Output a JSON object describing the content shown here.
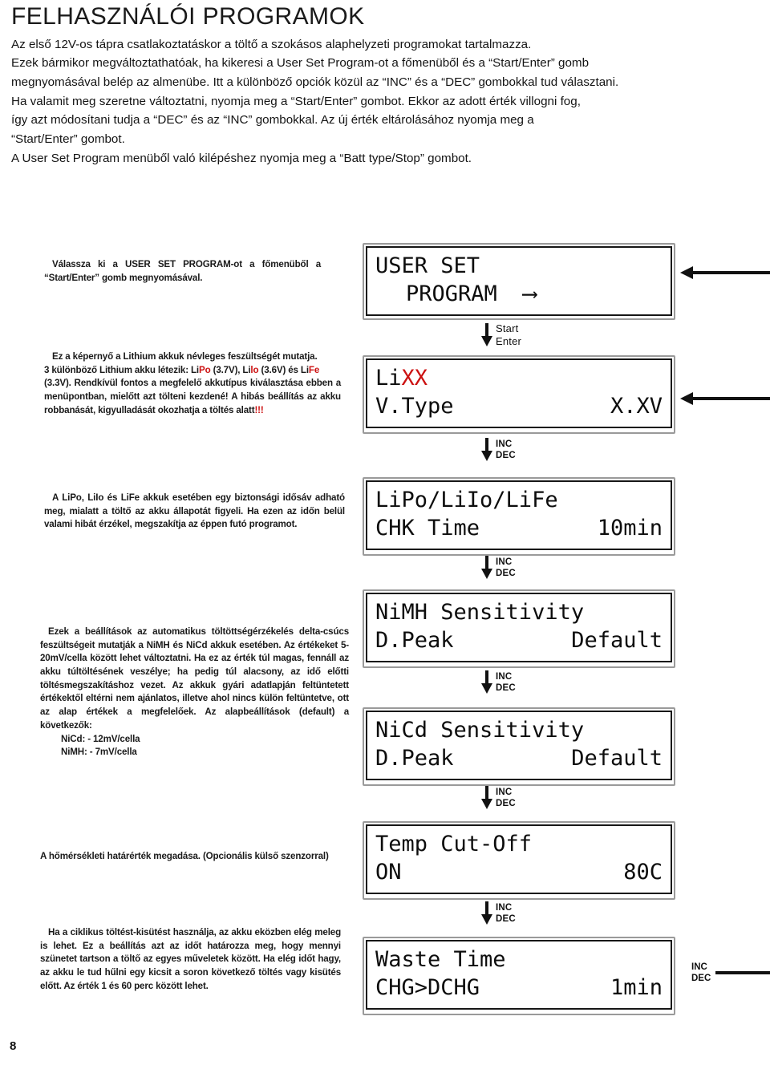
{
  "header": {
    "title": "FELHASZNÁLÓI PROGRAMOK",
    "paragraphs": [
      "Az első 12V-os tápra csatlakoztatáskor a töltő a szokásos alaphelyzeti programokat tartalmazza.",
      "Ezek bármikor megváltoztathatóak, ha kikeresi a User Set Program-ot a főmenüből és a “Start/Enter” gomb",
      "megnyomásával belép az almenübe. Itt a különböző opciók közül az “INC” és a “DEC” gombokkal tud választani.",
      "Ha valamit meg szeretne változtatni, nyomja meg a “Start/Enter” gombot. Ekkor az adott érték villogni fog,",
      "így azt módosítani tudja a “DEC” és az “INC” gombokkal. Az új érték eltárolásához nyomja meg a",
      "“Start/Enter” gombot.",
      "A User Set Program menüből való kilépéshez nyomja meg a “Batt type/Stop” gombot."
    ]
  },
  "notes": {
    "n1": "Válassza ki a USER SET PROGRAM-ot a főmenüből a “Start/Enter” gomb megnyomásával.",
    "n2_line1": "Ez a képernyő a Lithium akkuk névleges feszültségét mutatja.",
    "n2_line2_a": "3 különböző Lithium akku létezik: Li",
    "n2_red_po": "Po",
    "n2_line2_b": " (3.7V), Li",
    "n2_red_lo": "lo",
    "n2_line2_c": " (3.6V) és Li",
    "n2_red_fe": "Fe",
    "n2_line3": "(3.3V).  Rendkívül fontos a megfelelő akkutípus kiválasztása ebben a menüpontban, mielőtt azt tölteni kezdené! A hibás beállítás az akku robbanását, kigyulladását okozhatja a töltés alatt",
    "n2_red_bang": "!!!",
    "n3": "A LiPo, LiIo és LiFe akkuk esetében egy biztonsági idősáv adható meg, mialatt a töltő az akku állapotát figyeli. Ha ezen az időn belül valami hibát érzékel, megszakítja az éppen futó programot.",
    "n4_body": "Ezek a beállítások az automatikus töltöttségérzékelés delta-csúcs feszültségeit mutatják a NiMH és NiCd akkuk esetében. Az értékeket 5-20mV/cella között lehet változtatni. Ha ez az érték túl magas, fennáll az akku túltöltésének veszélye; ha pedig túl alacsony, az idő előtti töltésmegszakításhoz vezet. Az akkuk gyári adatlapján feltüntetett értékektől eltérni nem ajánlatos, illetve ahol nincs külön feltüntetve, ott az alap értékek a megfelelőek. Az alapbeállítások (default) a következők:",
    "n4_nicd": "NiCd: -  12mV/cella",
    "n4_nimh": "NiMH: - 7mV/cella",
    "n5": "A hőmérsékleti határérték megadása. (Opcionális külső szenzorral)",
    "n6": "Ha a ciklikus töltést-kisütést használja, az akku eközben elég meleg is lehet. Ez a beállítás azt az időt határozza meg, hogy mennyi szünetet tartson a töltő az egyes műveletek között. Ha elég időt hagy, az akku le tud hűlni egy kicsit a soron következő töltés vagy kisütés előtt. Az érték 1 és 60 perc között lehet."
  },
  "panels": [
    {
      "id": "user-set-program",
      "line1_left": "USER SET",
      "line1_right": "",
      "line2_left": "PROGRAM  ⟶",
      "line2_right": "",
      "line2_indent": true
    },
    {
      "id": "li-voltage-type",
      "line1_left_plain": "Li",
      "line1_left_red": "XX",
      "line1_right": "",
      "line2_left": "V.Type",
      "line2_right": "X.XV"
    },
    {
      "id": "lipo-chk-time",
      "line1_left": "LiPo/LiIo/LiFe",
      "line1_right": "",
      "line2_left": "CHK Time",
      "line2_right": "10min"
    },
    {
      "id": "nimh-sensitivity",
      "line1_left": "NiMH Sensitivity",
      "line1_right": "",
      "line2_left": "D.Peak",
      "line2_right": "Default"
    },
    {
      "id": "nicd-sensitivity",
      "line1_left": "NiCd Sensitivity",
      "line1_right": "",
      "line2_left": "D.Peak",
      "line2_right": "Default"
    },
    {
      "id": "temp-cut-off",
      "line1_left": "Temp Cut-Off",
      "line1_right": "",
      "line2_left": "ON",
      "line2_right": "80C"
    },
    {
      "id": "waste-time",
      "line1_left": "Waste Time",
      "line1_right": "",
      "line2_left": "CHG>DCHG",
      "line2_right": "1min"
    }
  ],
  "connectors": [
    {
      "top_label": "Start",
      "bottom_label": "Enter"
    },
    {
      "top_label": "INC",
      "bottom_label": "DEC"
    },
    {
      "top_label": "INC",
      "bottom_label": "DEC"
    },
    {
      "top_label": "INC",
      "bottom_label": "DEC"
    },
    {
      "top_label": "INC",
      "bottom_label": "DEC"
    },
    {
      "top_label": "INC",
      "bottom_label": "DEC"
    }
  ],
  "side_control": {
    "top_label": "INC",
    "bottom_label": "DEC"
  },
  "page_number": "8",
  "colors": {
    "red_accent": "#cc1111",
    "ink": "#111111",
    "bezel": "#9a9a9a"
  }
}
